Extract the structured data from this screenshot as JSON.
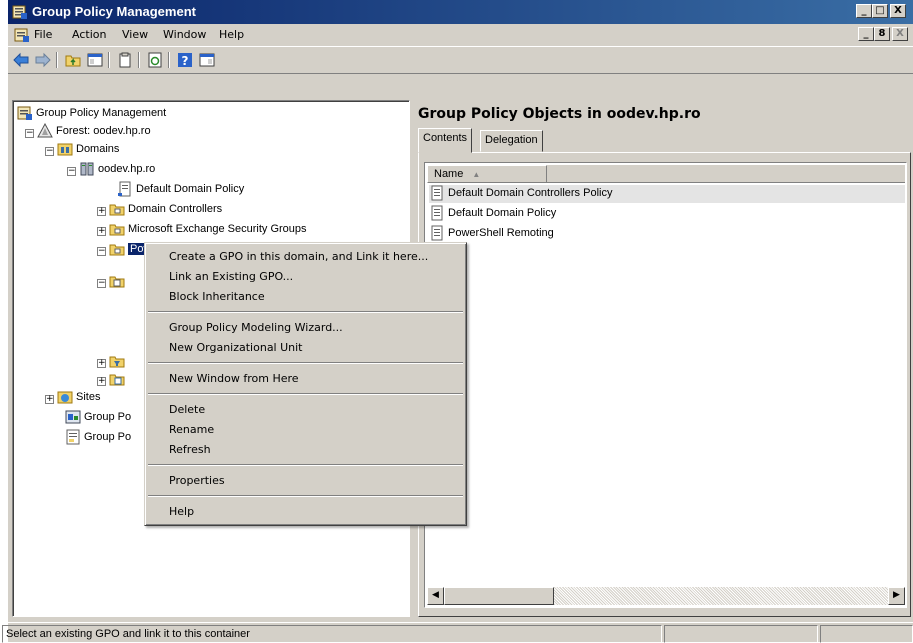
{
  "window": {
    "title": "Group Policy Management",
    "caption_buttons": [
      "_",
      "□",
      "X"
    ],
    "mdi_buttons": [
      "_",
      "8",
      "X"
    ]
  },
  "menu": {
    "items": [
      "File",
      "Action",
      "View",
      "Window",
      "Help"
    ]
  },
  "toolbar": {
    "icons": [
      "back-arrow-icon",
      "forward-arrow-icon",
      "up-folder-icon",
      "show-tree-icon",
      "clipboard-icon",
      "refresh-icon",
      "help-icon",
      "properties-icon"
    ]
  },
  "tree": {
    "root": "Group Policy Management",
    "forest": "Forest: oodev.hp.ro",
    "domains": "Domains",
    "domain": "oodev.hp.ro",
    "default_domain_policy": "Default Domain Policy",
    "domain_controllers": "Domain Controllers",
    "exchange_groups": "Microsoft Exchange Security Groups",
    "selected_ou": "PowerShellSe",
    "sites": "Sites",
    "group_policy_modeling": "Group Po",
    "group_policy_results": "Group Po"
  },
  "right_pane": {
    "title": "Group Policy Objects in oodev.hp.ro",
    "tabs": [
      "Contents",
      "Delegation"
    ],
    "column_name": "Name",
    "rows": [
      "Default Domain Controllers Policy",
      "Default Domain Policy",
      "PowerShell Remoting"
    ]
  },
  "context_menu": {
    "group1": [
      "Create a GPO in this domain, and Link it here...",
      "Link an Existing GPO...",
      "Block Inheritance"
    ],
    "group2": [
      "Group Policy Modeling Wizard...",
      "New Organizational Unit"
    ],
    "group3": [
      "New Window from Here"
    ],
    "group4": [
      "Delete",
      "Rename",
      "Refresh"
    ],
    "group5": [
      "Properties"
    ],
    "group6": [
      "Help"
    ]
  },
  "status": {
    "text": "Select an existing GPO and link it to this container"
  },
  "colors": {
    "title_gradient_start": "#0a246a",
    "title_gradient_end": "#3a6ea5",
    "chrome": "#d4d0c8",
    "selection": "#0a246a"
  }
}
